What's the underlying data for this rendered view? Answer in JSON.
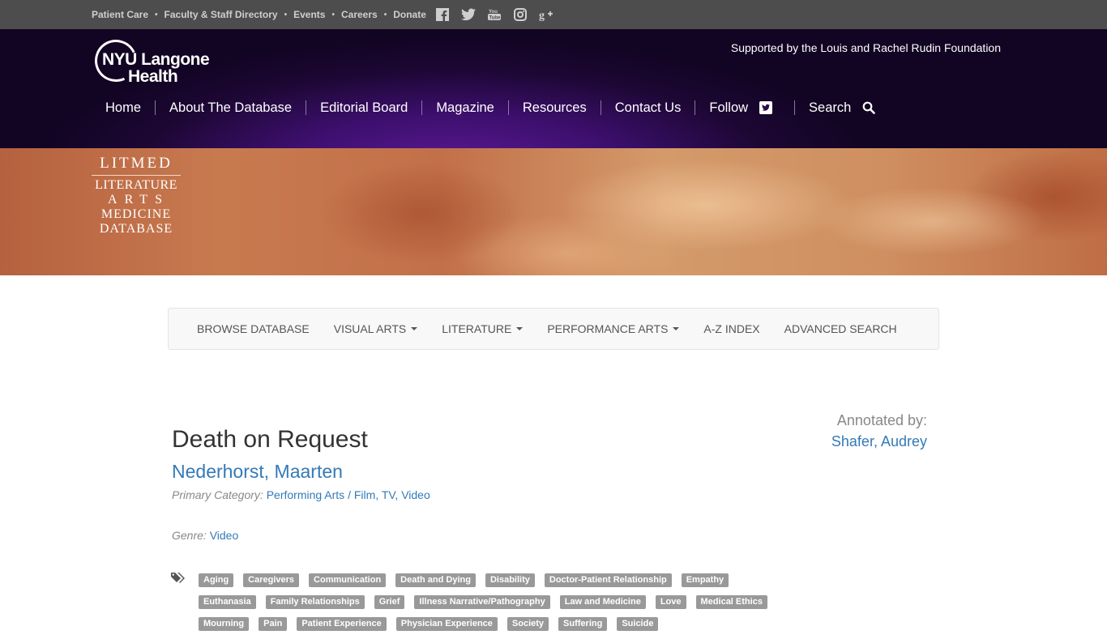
{
  "topbar": {
    "links": [
      "Patient Care",
      "Faculty & Staff Directory",
      "Events",
      "Careers",
      "Donate"
    ],
    "social_icons": [
      "facebook-icon",
      "twitter-icon",
      "youtube-icon",
      "instagram-icon",
      "google-plus-icon"
    ]
  },
  "header": {
    "logo_line1": "NYU Langone",
    "logo_line2": "Health",
    "supported_text": "Supported by the Louis and Rachel Rudin Foundation",
    "nav": {
      "home": "Home",
      "about": "About The Database",
      "editorial": "Editorial Board",
      "magazine": "Magazine",
      "resources": "Resources",
      "contact": "Contact Us",
      "follow": "Follow",
      "search": "Search"
    }
  },
  "hero": {
    "litmed": "LITMED",
    "line_literature": "LITERATURE",
    "line_arts": "ARTS",
    "line_medicine": "MEDICINE",
    "line_database": "DATABASE"
  },
  "dbnav": {
    "browse": "BROWSE DATABASE",
    "visual_arts": "VISUAL ARTS",
    "literature": "LITERATURE",
    "performance_arts": "PERFORMANCE ARTS",
    "az_index": "A-Z INDEX",
    "advanced_search": "ADVANCED SEARCH"
  },
  "entry": {
    "title": "Death on Request",
    "author": "Nederhorst, Maarten",
    "primary_category_label": "Primary Category:",
    "category_1": "Performing Arts",
    "category_sep": "/",
    "category_2": "Film, TV, Video",
    "genre_label": "Genre:",
    "genre": "Video",
    "annotated_by_label": "Annotated by:",
    "annotator": "Shafer, Audrey",
    "tags": [
      "Aging",
      "Caregivers",
      "Communication",
      "Death and Dying",
      "Disability",
      "Doctor-Patient Relationship",
      "Empathy",
      "Euthanasia",
      "Family Relationships",
      "Grief",
      "Illness Narrative/Pathography",
      "Law and Medicine",
      "Love",
      "Medical Ethics",
      "Mourning",
      "Pain",
      "Patient Experience",
      "Physician Experience",
      "Society",
      "Suffering",
      "Suicide"
    ]
  },
  "colors": {
    "topbar_bg": "#4d4d4d",
    "header_purple": "#3d0f6e",
    "link_blue": "#337ab7",
    "tag_gray": "#999999"
  }
}
